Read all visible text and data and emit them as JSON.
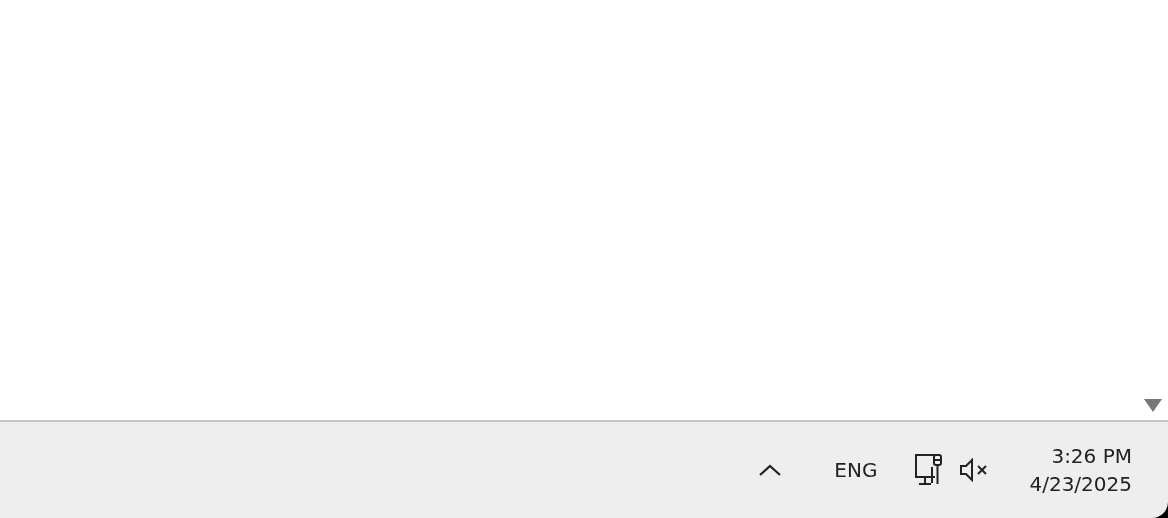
{
  "taskbar": {
    "language": "ENG",
    "volume": {
      "muted": true
    },
    "clock": {
      "time": "3:26 PM",
      "date": "4/23/2025"
    }
  }
}
